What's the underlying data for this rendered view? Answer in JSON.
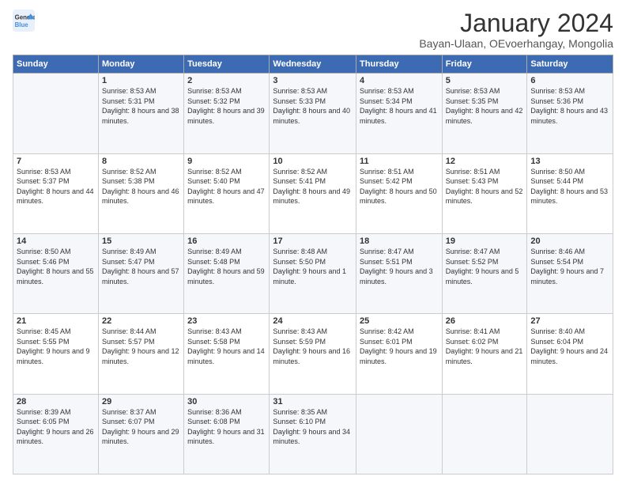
{
  "logo": {
    "line1": "General",
    "line2": "Blue"
  },
  "title": "January 2024",
  "subtitle": "Bayan-Ulaan, OEvoerhangay, Mongolia",
  "days_header": [
    "Sunday",
    "Monday",
    "Tuesday",
    "Wednesday",
    "Thursday",
    "Friday",
    "Saturday"
  ],
  "weeks": [
    [
      {
        "day": "",
        "sunrise": "",
        "sunset": "",
        "daylight": ""
      },
      {
        "day": "1",
        "sunrise": "Sunrise: 8:53 AM",
        "sunset": "Sunset: 5:31 PM",
        "daylight": "Daylight: 8 hours and 38 minutes."
      },
      {
        "day": "2",
        "sunrise": "Sunrise: 8:53 AM",
        "sunset": "Sunset: 5:32 PM",
        "daylight": "Daylight: 8 hours and 39 minutes."
      },
      {
        "day": "3",
        "sunrise": "Sunrise: 8:53 AM",
        "sunset": "Sunset: 5:33 PM",
        "daylight": "Daylight: 8 hours and 40 minutes."
      },
      {
        "day": "4",
        "sunrise": "Sunrise: 8:53 AM",
        "sunset": "Sunset: 5:34 PM",
        "daylight": "Daylight: 8 hours and 41 minutes."
      },
      {
        "day": "5",
        "sunrise": "Sunrise: 8:53 AM",
        "sunset": "Sunset: 5:35 PM",
        "daylight": "Daylight: 8 hours and 42 minutes."
      },
      {
        "day": "6",
        "sunrise": "Sunrise: 8:53 AM",
        "sunset": "Sunset: 5:36 PM",
        "daylight": "Daylight: 8 hours and 43 minutes."
      }
    ],
    [
      {
        "day": "7",
        "sunrise": "Sunrise: 8:53 AM",
        "sunset": "Sunset: 5:37 PM",
        "daylight": "Daylight: 8 hours and 44 minutes."
      },
      {
        "day": "8",
        "sunrise": "Sunrise: 8:52 AM",
        "sunset": "Sunset: 5:38 PM",
        "daylight": "Daylight: 8 hours and 46 minutes."
      },
      {
        "day": "9",
        "sunrise": "Sunrise: 8:52 AM",
        "sunset": "Sunset: 5:40 PM",
        "daylight": "Daylight: 8 hours and 47 minutes."
      },
      {
        "day": "10",
        "sunrise": "Sunrise: 8:52 AM",
        "sunset": "Sunset: 5:41 PM",
        "daylight": "Daylight: 8 hours and 49 minutes."
      },
      {
        "day": "11",
        "sunrise": "Sunrise: 8:51 AM",
        "sunset": "Sunset: 5:42 PM",
        "daylight": "Daylight: 8 hours and 50 minutes."
      },
      {
        "day": "12",
        "sunrise": "Sunrise: 8:51 AM",
        "sunset": "Sunset: 5:43 PM",
        "daylight": "Daylight: 8 hours and 52 minutes."
      },
      {
        "day": "13",
        "sunrise": "Sunrise: 8:50 AM",
        "sunset": "Sunset: 5:44 PM",
        "daylight": "Daylight: 8 hours and 53 minutes."
      }
    ],
    [
      {
        "day": "14",
        "sunrise": "Sunrise: 8:50 AM",
        "sunset": "Sunset: 5:46 PM",
        "daylight": "Daylight: 8 hours and 55 minutes."
      },
      {
        "day": "15",
        "sunrise": "Sunrise: 8:49 AM",
        "sunset": "Sunset: 5:47 PM",
        "daylight": "Daylight: 8 hours and 57 minutes."
      },
      {
        "day": "16",
        "sunrise": "Sunrise: 8:49 AM",
        "sunset": "Sunset: 5:48 PM",
        "daylight": "Daylight: 8 hours and 59 minutes."
      },
      {
        "day": "17",
        "sunrise": "Sunrise: 8:48 AM",
        "sunset": "Sunset: 5:50 PM",
        "daylight": "Daylight: 9 hours and 1 minute."
      },
      {
        "day": "18",
        "sunrise": "Sunrise: 8:47 AM",
        "sunset": "Sunset: 5:51 PM",
        "daylight": "Daylight: 9 hours and 3 minutes."
      },
      {
        "day": "19",
        "sunrise": "Sunrise: 8:47 AM",
        "sunset": "Sunset: 5:52 PM",
        "daylight": "Daylight: 9 hours and 5 minutes."
      },
      {
        "day": "20",
        "sunrise": "Sunrise: 8:46 AM",
        "sunset": "Sunset: 5:54 PM",
        "daylight": "Daylight: 9 hours and 7 minutes."
      }
    ],
    [
      {
        "day": "21",
        "sunrise": "Sunrise: 8:45 AM",
        "sunset": "Sunset: 5:55 PM",
        "daylight": "Daylight: 9 hours and 9 minutes."
      },
      {
        "day": "22",
        "sunrise": "Sunrise: 8:44 AM",
        "sunset": "Sunset: 5:57 PM",
        "daylight": "Daylight: 9 hours and 12 minutes."
      },
      {
        "day": "23",
        "sunrise": "Sunrise: 8:43 AM",
        "sunset": "Sunset: 5:58 PM",
        "daylight": "Daylight: 9 hours and 14 minutes."
      },
      {
        "day": "24",
        "sunrise": "Sunrise: 8:43 AM",
        "sunset": "Sunset: 5:59 PM",
        "daylight": "Daylight: 9 hours and 16 minutes."
      },
      {
        "day": "25",
        "sunrise": "Sunrise: 8:42 AM",
        "sunset": "Sunset: 6:01 PM",
        "daylight": "Daylight: 9 hours and 19 minutes."
      },
      {
        "day": "26",
        "sunrise": "Sunrise: 8:41 AM",
        "sunset": "Sunset: 6:02 PM",
        "daylight": "Daylight: 9 hours and 21 minutes."
      },
      {
        "day": "27",
        "sunrise": "Sunrise: 8:40 AM",
        "sunset": "Sunset: 6:04 PM",
        "daylight": "Daylight: 9 hours and 24 minutes."
      }
    ],
    [
      {
        "day": "28",
        "sunrise": "Sunrise: 8:39 AM",
        "sunset": "Sunset: 6:05 PM",
        "daylight": "Daylight: 9 hours and 26 minutes."
      },
      {
        "day": "29",
        "sunrise": "Sunrise: 8:37 AM",
        "sunset": "Sunset: 6:07 PM",
        "daylight": "Daylight: 9 hours and 29 minutes."
      },
      {
        "day": "30",
        "sunrise": "Sunrise: 8:36 AM",
        "sunset": "Sunset: 6:08 PM",
        "daylight": "Daylight: 9 hours and 31 minutes."
      },
      {
        "day": "31",
        "sunrise": "Sunrise: 8:35 AM",
        "sunset": "Sunset: 6:10 PM",
        "daylight": "Daylight: 9 hours and 34 minutes."
      },
      {
        "day": "",
        "sunrise": "",
        "sunset": "",
        "daylight": ""
      },
      {
        "day": "",
        "sunrise": "",
        "sunset": "",
        "daylight": ""
      },
      {
        "day": "",
        "sunrise": "",
        "sunset": "",
        "daylight": ""
      }
    ]
  ]
}
